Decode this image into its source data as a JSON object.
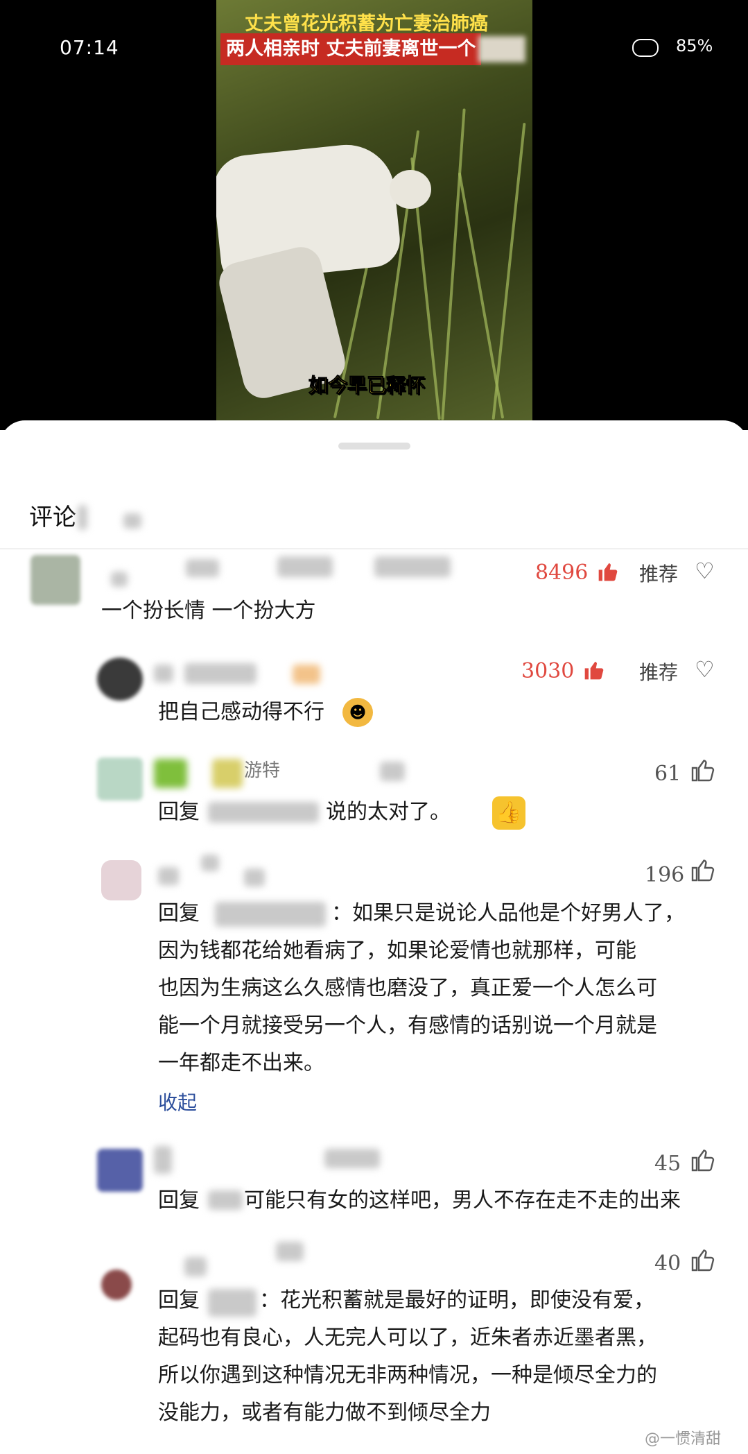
{
  "status_bar": {
    "time": "07:14",
    "battery": "85%"
  },
  "video": {
    "caption_line1": "丈夫曾花光积蓄为亡妻治肺癌",
    "caption_line2": "两人相亲时 丈夫前妻离世一个",
    "subtitle": "如今早已释怀"
  },
  "sheet": {
    "title": "评论"
  },
  "comments": [
    {
      "text": "一个扮长情 一个扮大方",
      "likes": "8496",
      "recommend": "推荐"
    },
    {
      "text": "把自己感动得不行",
      "likes": "3030",
      "recommend": "推荐"
    },
    {
      "name_suffix": "游特",
      "text_prefix": "回复",
      "text_rest": "说的太对了。",
      "likes": "61"
    },
    {
      "text_prefix": "回复",
      "lines": [
        "：如果只是说论人品他是个好男人了，",
        "因为钱都花给她看病了，如果论爱情也就那样，可能",
        "也因为生病这么久感情也磨没了，真正爱一个人怎么可",
        "能一个月就接受另一个人，有感情的话别说一个月就是",
        "一年都走不出来。"
      ],
      "collapse": "收起",
      "likes": "196"
    },
    {
      "text_prefix": "回复",
      "text_rest": "可能只有女的这样吧，男人不存在走不走的出来",
      "likes": "45"
    },
    {
      "text_prefix": "回复",
      "lines": [
        "：花光积蓄就是最好的证明，即使没有爱，",
        "起码也有良心，人无完人可以了，近朱者赤近墨者黑，",
        "所以你遇到这种情况无非两种情况，一种是倾尽全力的",
        "没能力，或者有能力做不到倾尽全力"
      ],
      "likes": "40"
    }
  ],
  "watermark": "@一惯清甜",
  "colors": {
    "like_red": "#e0483f",
    "link_blue": "#2d4f9c",
    "caption_bg": "#c62b22",
    "caption_yellow": "#ffe14a"
  },
  "icons": [
    "thumbs-up-icon",
    "heart-icon",
    "cat-emoji-icon",
    "thumbs-up-emoji-icon"
  ]
}
